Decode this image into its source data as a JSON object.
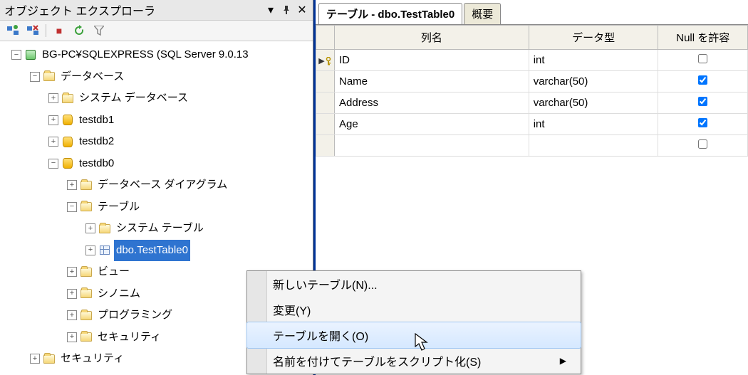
{
  "explorer": {
    "title": "オブジェクト エクスプローラ",
    "server": "BG-PC¥SQLEXPRESS (SQL Server 9.0.13",
    "nodes": {
      "databases": "データベース",
      "sys_databases": "システム データベース",
      "testdb1": "testdb1",
      "testdb2": "testdb2",
      "testdb0": "testdb0",
      "db_diagrams": "データベース ダイアグラム",
      "tables": "テーブル",
      "sys_tables": "システム テーブル",
      "selected_table": "dbo.TestTable0",
      "views": "ビュー",
      "synonyms": "シノニム",
      "programming": "プログラミング",
      "security": "セキュリティ",
      "security2": "セキュリティ"
    }
  },
  "tabs": {
    "designer": "テーブル - dbo.TestTable0",
    "summary": "概要"
  },
  "grid": {
    "headers": {
      "name": "列名",
      "type": "データ型",
      "allow_null": "Null を許容"
    },
    "rows": [
      {
        "name": "ID",
        "type": "int",
        "allow_null": false,
        "pk": true
      },
      {
        "name": "Name",
        "type": "varchar(50)",
        "allow_null": true,
        "pk": false
      },
      {
        "name": "Address",
        "type": "varchar(50)",
        "allow_null": true,
        "pk": false
      },
      {
        "name": "Age",
        "type": "int",
        "allow_null": true,
        "pk": false
      }
    ]
  },
  "context_menu": {
    "new_table": "新しいテーブル(N)...",
    "modify": "変更(Y)",
    "open_table": "テーブルを開く(O)",
    "script_as": "名前を付けてテーブルをスクリプト化(S)"
  }
}
